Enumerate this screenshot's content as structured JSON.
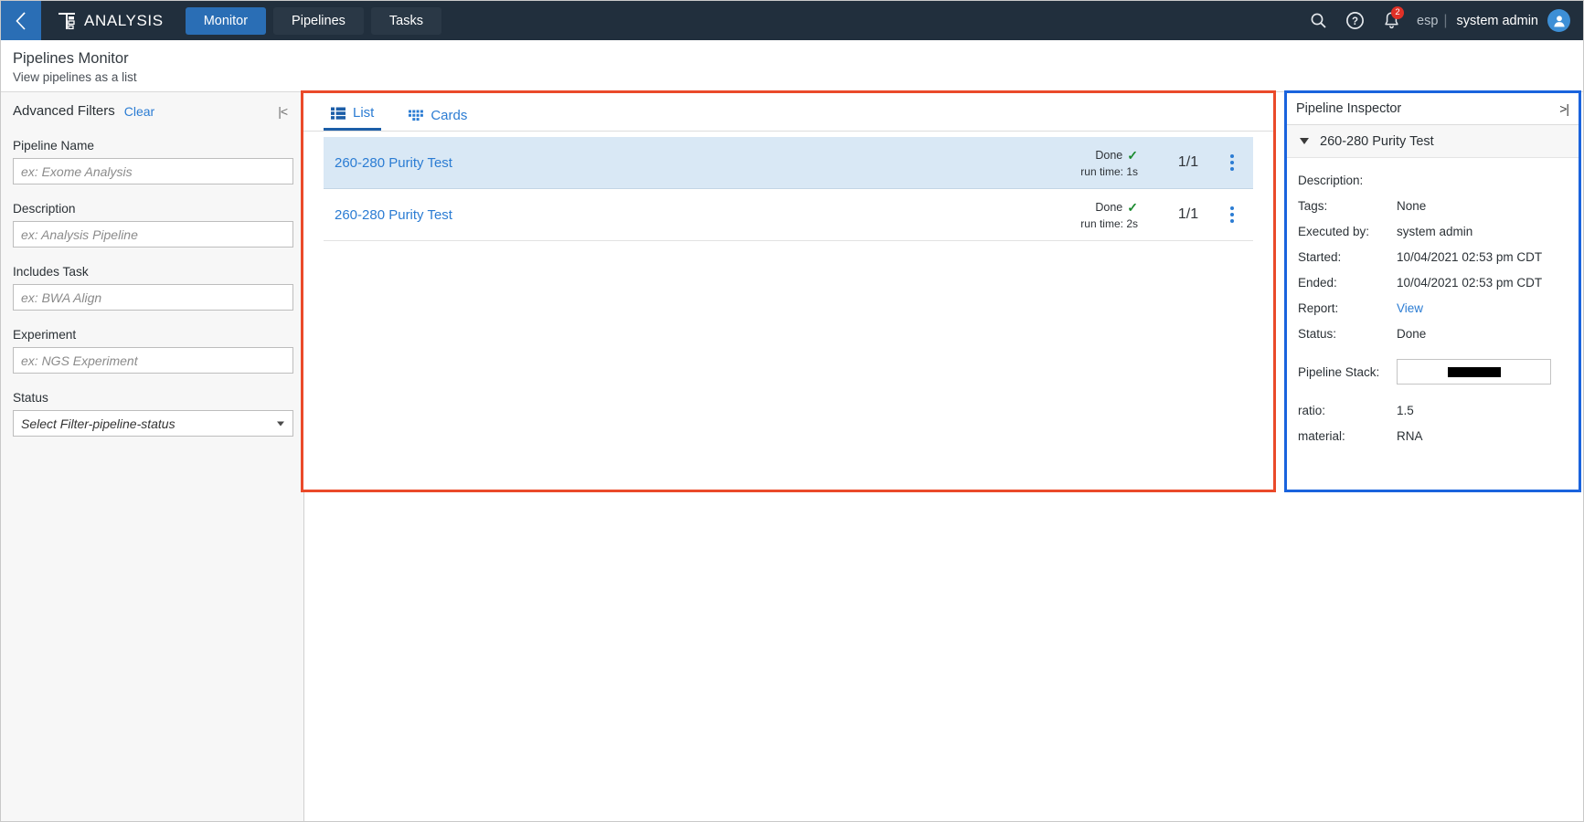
{
  "topnav": {
    "back_icon": "chevron-left-icon",
    "brand": "ANALYSIS",
    "brand_icon": "pipeline-logo-icon",
    "tabs": [
      {
        "label": "Monitor",
        "active": true
      },
      {
        "label": "Pipelines",
        "active": false
      },
      {
        "label": "Tasks",
        "active": false
      }
    ],
    "search_icon": "search-icon",
    "help_icon": "help-circle-icon",
    "bell_icon": "bell-icon",
    "notification_count": "2",
    "language": "esp",
    "separator": "|",
    "username": "system admin",
    "avatar_icon": "user-avatar-icon",
    "bar_color": "#212f3d",
    "accent_color": "#2a6eb5",
    "badge_color": "#e03127"
  },
  "pagehead": {
    "title": "Pipelines Monitor",
    "subtitle": "View pipelines as a list"
  },
  "filters": {
    "title": "Advanced Filters",
    "clear_label": "Clear",
    "collapse_icon": "collapse-left-icon",
    "collapse_glyph": "|<",
    "fields": [
      {
        "label": "Pipeline Name",
        "placeholder": "ex: Exome Analysis",
        "value": ""
      },
      {
        "label": "Description",
        "placeholder": "ex: Analysis Pipeline",
        "value": ""
      },
      {
        "label": "Includes Task",
        "placeholder": "ex: BWA Align",
        "value": ""
      },
      {
        "label": "Experiment",
        "placeholder": "ex: NGS Experiment",
        "value": ""
      }
    ],
    "status": {
      "label": "Status",
      "selected": "Select Filter-pipeline-status"
    }
  },
  "main": {
    "highlight_color": "#ea4a2a",
    "tabs": [
      {
        "label": "List",
        "icon": "list-view-icon",
        "active": true
      },
      {
        "label": "Cards",
        "icon": "cards-view-icon",
        "active": false
      }
    ],
    "rows": [
      {
        "name": "260-280 Purity Test",
        "status": "Done",
        "status_icon": "check-icon",
        "run_time": "run time: 1s",
        "count": "1/1",
        "menu_icon": "kebab-menu-icon",
        "selected": true
      },
      {
        "name": "260-280 Purity Test",
        "status": "Done",
        "status_icon": "check-icon",
        "run_time": "run time: 2s",
        "count": "1/1",
        "menu_icon": "kebab-menu-icon",
        "selected": false
      }
    ]
  },
  "inspector": {
    "highlight_color": "#1a63dd",
    "title": "Pipeline Inspector",
    "collapse_icon": "collapse-right-icon",
    "collapse_glyph": ">|",
    "section_name": "260-280 Purity Test",
    "properties": [
      {
        "key": "Description:",
        "value": ""
      },
      {
        "key": "Tags:",
        "value": "None"
      },
      {
        "key": "Executed by:",
        "value": "system admin"
      },
      {
        "key": "Started:",
        "value": "10/04/2021 02:53 pm CDT"
      },
      {
        "key": "Ended:",
        "value": "10/04/2021 02:53 pm CDT"
      },
      {
        "key": "Report:",
        "value": "View",
        "link": true
      },
      {
        "key": "Status:",
        "value": "Done"
      }
    ],
    "pipeline_stack": {
      "key": "Pipeline Stack:",
      "value_redacted": true
    },
    "extras": [
      {
        "key": "ratio:",
        "value": "1.5"
      },
      {
        "key": "material:",
        "value": "RNA"
      }
    ]
  }
}
